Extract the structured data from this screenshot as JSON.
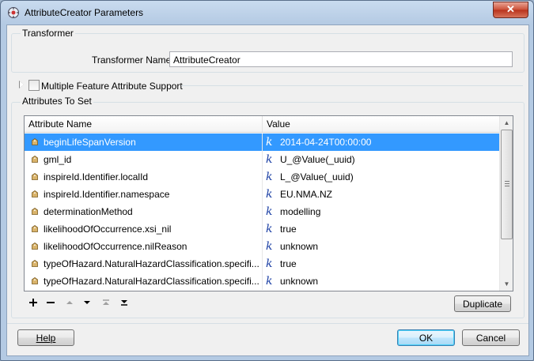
{
  "window": {
    "title": "AttributeCreator Parameters",
    "close_label": "✕"
  },
  "transformer": {
    "group_label": "Transformer",
    "name_label": "Transformer Name:",
    "name_value": "AttributeCreator"
  },
  "multiple_support": {
    "label": "Multiple Feature Attribute Support",
    "checked": false
  },
  "attributes": {
    "group_label": "Attributes To Set",
    "columns": [
      "Attribute Name",
      "Value"
    ],
    "rows": [
      {
        "name": "beginLifeSpanVersion",
        "value": "2014-04-24T00:00:00",
        "selected": true
      },
      {
        "name": "gml_id",
        "value": "U_@Value(_uuid)"
      },
      {
        "name": "inspireId.Identifier.localId",
        "value": "L_@Value(_uuid)"
      },
      {
        "name": "inspireId.Identifier.namespace",
        "value": "EU.NMA.NZ"
      },
      {
        "name": "determinationMethod",
        "value": "modelling"
      },
      {
        "name": "likelihoodOfOccurrence.xsi_nil",
        "value": "true"
      },
      {
        "name": "likelihoodOfOccurrence.nilReason",
        "value": "unknown"
      },
      {
        "name": "typeOfHazard.NaturalHazardClassification.specifi...",
        "value": "true"
      },
      {
        "name": "typeOfHazard.NaturalHazardClassification.specifi...",
        "value": "unknown"
      }
    ],
    "value_icon": "k-expression-icon",
    "row_icon": "attribute-tag-icon"
  },
  "toolbar": {
    "add_icon": "plus-icon",
    "remove_icon": "minus-icon",
    "up_icon": "move-up-icon",
    "down_icon": "move-down-icon",
    "top_icon": "move-to-top-icon",
    "bottom_icon": "move-to-bottom-icon",
    "duplicate_label": "Duplicate"
  },
  "footer": {
    "help_label": "Help",
    "ok_label": "OK",
    "cancel_label": "Cancel"
  },
  "colors": {
    "selection": "#3399ff",
    "title_bar": "#b9d1ea",
    "close_button": "#c7432b"
  }
}
